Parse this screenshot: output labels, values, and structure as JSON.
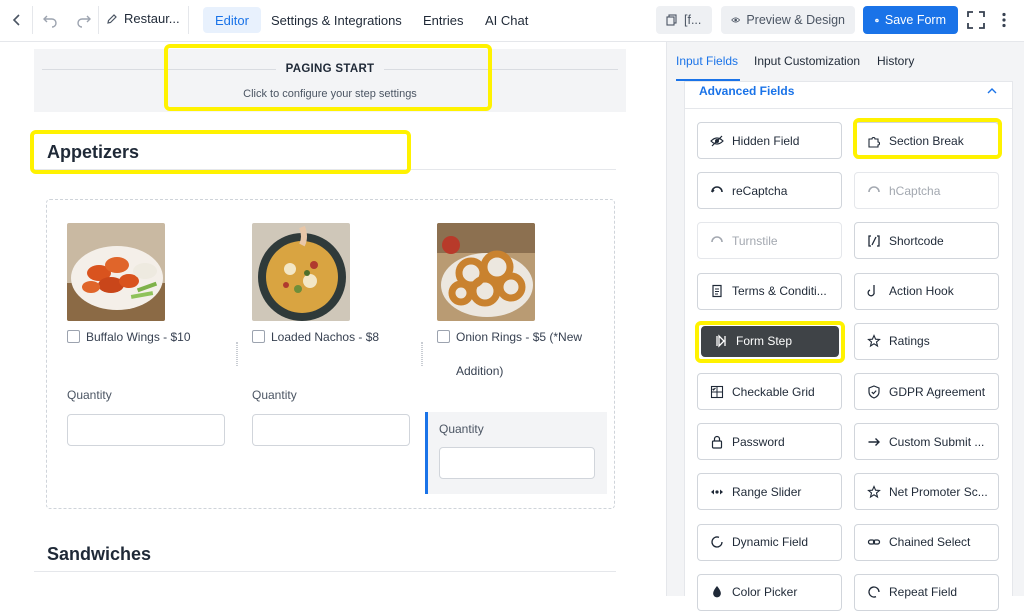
{
  "topbar": {
    "form_title": "Restaur...",
    "tabs": [
      "Editor",
      "Settings & Integrations",
      "Entries",
      "AI Chat"
    ],
    "shortcode_chip": "[f...",
    "preview_label": "Preview & Design",
    "save_label": "Save Form",
    "accent": "#1a73e8"
  },
  "editor": {
    "paging_title": "PAGING START",
    "paging_subtitle": "Click to configure your step settings",
    "section1_title": "Appetizers",
    "section2_title": "Sandwiches",
    "options": [
      {
        "label": "Buffalo Wings - $10"
      },
      {
        "label": "Loaded Nachos - $8"
      },
      {
        "label": "Onion Rings - $5 (*New Addition)"
      }
    ],
    "quantity_label": "Quantity"
  },
  "panel": {
    "tabs": [
      "Input Fields",
      "Input Customization",
      "History"
    ],
    "section_title": "Advanced Fields",
    "fields": [
      {
        "label": "Hidden Field",
        "icon": "eye-slash-icon",
        "disabled": false
      },
      {
        "label": "Section Break",
        "icon": "puzzle-icon",
        "disabled": false
      },
      {
        "label": "reCaptcha",
        "icon": "recaptcha-icon",
        "disabled": false
      },
      {
        "label": "hCaptcha",
        "icon": "hcaptcha-icon",
        "disabled": true
      },
      {
        "label": "Turnstile",
        "icon": "turnstile-icon",
        "disabled": true
      },
      {
        "label": "Shortcode",
        "icon": "shortcode-icon",
        "disabled": false
      },
      {
        "label": "Terms & Conditi...",
        "icon": "document-icon",
        "disabled": false
      },
      {
        "label": "Action Hook",
        "icon": "hook-icon",
        "disabled": false
      },
      {
        "label": "Form Step",
        "icon": "step-icon",
        "disabled": false
      },
      {
        "label": "Ratings",
        "icon": "star-icon",
        "disabled": false
      },
      {
        "label": "Checkable Grid",
        "icon": "grid-check-icon",
        "disabled": false
      },
      {
        "label": "GDPR Agreement",
        "icon": "shield-icon",
        "disabled": false
      },
      {
        "label": "Password",
        "icon": "lock-icon",
        "disabled": false
      },
      {
        "label": "Custom Submit ...",
        "icon": "arrow-right-icon",
        "disabled": false
      },
      {
        "label": "Range Slider",
        "icon": "range-icon",
        "disabled": false
      },
      {
        "label": "Net Promoter Sc...",
        "icon": "star-outline-icon",
        "disabled": false
      },
      {
        "label": "Dynamic Field",
        "icon": "refresh-icon",
        "disabled": false
      },
      {
        "label": "Chained Select",
        "icon": "link-icon",
        "disabled": false
      },
      {
        "label": "Color Picker",
        "icon": "drop-icon",
        "disabled": false
      },
      {
        "label": "Repeat Field",
        "icon": "repeat-icon",
        "disabled": false
      }
    ]
  },
  "colors": {
    "highlight": "#fff200",
    "accent": "#1a73e8",
    "dark_button": "#3f4347"
  }
}
